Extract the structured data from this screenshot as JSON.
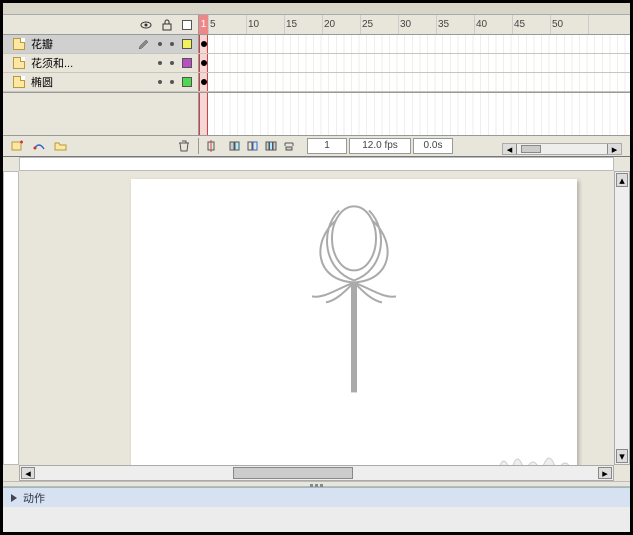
{
  "ruler": {
    "frames": [
      "1",
      "5",
      "10",
      "15",
      "20",
      "25",
      "30",
      "35",
      "40",
      "45",
      "50"
    ]
  },
  "layers": [
    {
      "name": "花瓣",
      "color": "#f2f25a",
      "selected": true,
      "editing": true
    },
    {
      "name": "花须和...",
      "color": "#b94fc0",
      "selected": false,
      "editing": false
    },
    {
      "name": "椭圆",
      "color": "#4fd84f",
      "selected": false,
      "editing": false
    }
  ],
  "status": {
    "frame": "1",
    "fps": "12.0 fps",
    "time": "0.0s"
  },
  "panel": {
    "title": "动作"
  },
  "icons": {
    "eye": "eye-icon",
    "lock": "lock-icon",
    "outline": "outline-icon",
    "new_layer": "new-layer-icon",
    "new_motion": "new-motion-guide-icon",
    "new_folder": "new-folder-icon",
    "trash": "trash-icon",
    "center": "center-frame-icon",
    "onion1": "onion-skin-icon",
    "onion2": "onion-outline-icon",
    "onion3": "edit-multi-icon",
    "marker": "onion-markers-icon"
  }
}
